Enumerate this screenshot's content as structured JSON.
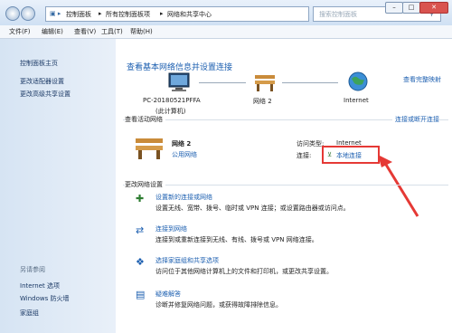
{
  "address": {
    "crumbs": [
      "控制面板",
      "所有控制面板项",
      "网络和共享中心"
    ],
    "search_placeholder": "搜索控制面板"
  },
  "menubar": [
    "文件(F)",
    "编辑(E)",
    "查看(V)",
    "工具(T)",
    "帮助(H)"
  ],
  "sidebar": {
    "home": "控制面板主页",
    "items": [
      "更改适配器设置",
      "更改高级共享设置"
    ],
    "see_also_title": "另请参阅",
    "see_also": [
      "Internet 选项",
      "Windows 防火墙",
      "家庭组"
    ]
  },
  "main": {
    "title": "查看基本网络信息并设置连接",
    "full_map": "查看完整映射",
    "map": {
      "computer_name": "PC-20180521PFFA",
      "computer_sub": "(此计算机)",
      "network": "网络 2",
      "internet": "Internet"
    },
    "active_title": "查看活动网络",
    "connect_link": "连接或断开连接",
    "active": {
      "name": "网络 2",
      "type": "公用网络",
      "access_label": "访问类型:",
      "access_value": "Internet",
      "conn_label": "连接:",
      "conn_value": "本地连接"
    },
    "change_title": "更改网络设置",
    "tasks": [
      {
        "title": "设置新的连接或网络",
        "desc": "设置无线、宽带、拨号、临时或 VPN 连接；或设置路由器或访问点。"
      },
      {
        "title": "连接到网络",
        "desc": "连接到或重新连接到无线、有线、拨号或 VPN 网络连接。"
      },
      {
        "title": "选择家庭组和共享选项",
        "desc": "访问位于其他网络计算机上的文件和打印机，或更改共享设置。"
      },
      {
        "title": "疑难解答",
        "desc": "诊断并修复网络问题，或获得故障排除信息。"
      }
    ]
  },
  "colors": {
    "link": "#1c5fb0",
    "highlight": "#e53935"
  }
}
